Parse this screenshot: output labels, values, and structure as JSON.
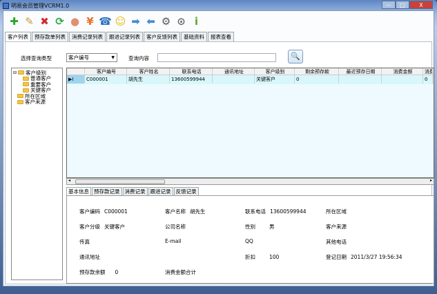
{
  "window": {
    "title": "明易会员管理VCRM1.0",
    "minimize": "—",
    "maximize": "□",
    "close": "X"
  },
  "toolbar": [
    {
      "icon": "add-icon",
      "glyph": "✚",
      "color": "#2aa52a"
    },
    {
      "icon": "edit-pencil-icon",
      "glyph": "✎",
      "color": "#c89b3a"
    },
    {
      "icon": "delete-icon",
      "glyph": "✖",
      "color": "#d42a2a"
    },
    {
      "icon": "refresh-icon",
      "glyph": "⟳",
      "color": "#2fa84a"
    },
    {
      "icon": "feedback-icon",
      "glyph": "●",
      "color": "#e09070"
    },
    {
      "icon": "yuan-icon",
      "glyph": "¥",
      "color": "#e8702a"
    },
    {
      "icon": "phone-icon",
      "glyph": "☎",
      "color": "#2a6fc0"
    },
    {
      "icon": "support-headset-icon",
      "glyph": "☺",
      "color": "#e8b800"
    },
    {
      "icon": "arrow-right-icon",
      "glyph": "➡",
      "color": "#4a8ad0"
    },
    {
      "icon": "arrow-left-icon",
      "glyph": "⬅",
      "color": "#4a8ad0"
    },
    {
      "icon": "settings-tools-icon",
      "glyph": "⚙",
      "color": "#555"
    },
    {
      "icon": "backup-drive-icon",
      "glyph": "⊙",
      "color": "#666"
    },
    {
      "icon": "info-icon",
      "glyph": "i",
      "color": "#5aa82a"
    }
  ],
  "tabs": [
    "客户列表",
    "预存款单列表",
    "消费记录列表",
    "跟进记录列表",
    "客户反馈列表",
    "基础资料",
    "报表查看"
  ],
  "search": {
    "type_label": "选择查询类型",
    "type_value": "客户编号",
    "content_label": "查询内容",
    "content_value": ""
  },
  "tree": {
    "root": "客户级别",
    "children": [
      "普通客户",
      "重要客户",
      "关键客户"
    ],
    "others": [
      "所在区域",
      "客户来源"
    ]
  },
  "grid": {
    "columns": [
      "客户编号",
      "客户姓名",
      "联系电话",
      "通讯地址",
      "客户级别",
      "剩余预存款",
      "最近预存日期",
      "消费金额",
      "消费"
    ],
    "rows": [
      [
        "C000001",
        "胡先生",
        "13600599944",
        "",
        "关键客户",
        "0",
        "",
        "",
        "0"
      ]
    ],
    "row_indicator": "▶I"
  },
  "subtabs": [
    "基本信息",
    "预存款记录",
    "消费记录",
    "跟进记录",
    "反馈记录"
  ],
  "info": {
    "customer_code": {
      "label": "客户编码",
      "value": "C000001"
    },
    "customer_name": {
      "label": "客户名称",
      "value": "胡先生"
    },
    "phone": {
      "label": "联系电话",
      "value": "13600599944"
    },
    "region": {
      "label": "所在区域",
      "value": ""
    },
    "level": {
      "label": "客户分级",
      "value": "关键客户"
    },
    "company": {
      "label": "公司名称",
      "value": ""
    },
    "gender": {
      "label": "性别",
      "value": "男"
    },
    "source": {
      "label": "客户来源",
      "value": ""
    },
    "fax": {
      "label": "传真",
      "value": ""
    },
    "email": {
      "label": "E-mail",
      "value": ""
    },
    "qq": {
      "label": "QQ",
      "value": ""
    },
    "other_phone": {
      "label": "其他电话",
      "value": ""
    },
    "address": {
      "label": "通讯地址",
      "value": ""
    },
    "discount": {
      "label": "折扣",
      "value": "100"
    },
    "register_date": {
      "label": "登记日期",
      "value": "2011/3/27 19:56:34"
    },
    "prepaid_balance": {
      "label": "预存款余额",
      "value": "0"
    },
    "consume_total": {
      "label": "消费金额合计",
      "value": ""
    }
  }
}
